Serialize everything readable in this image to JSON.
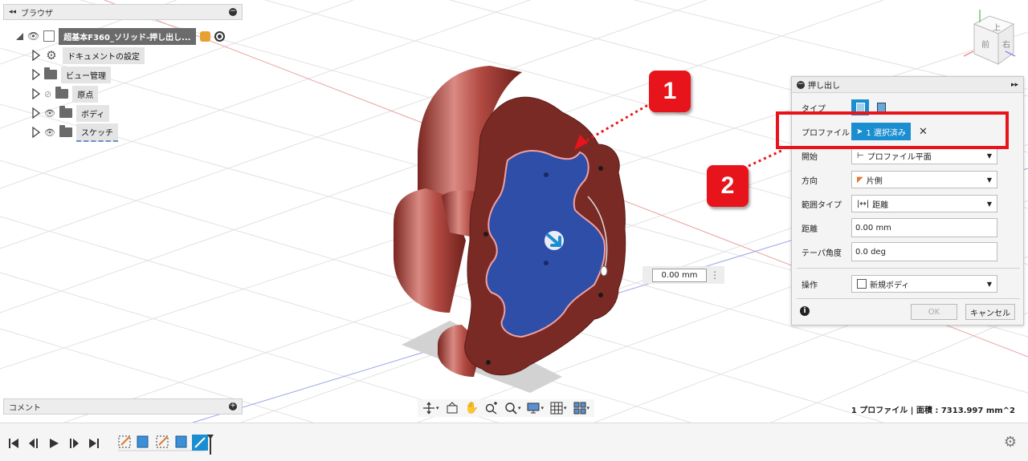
{
  "browser": {
    "title": "ブラウザ",
    "root_label": "超基本F360_ソリッド-押し出し...",
    "items": [
      {
        "label": "ドキュメントの設定",
        "icon": "gear-icon"
      },
      {
        "label": "ビュー管理",
        "icon": "folder-icon"
      },
      {
        "label": "原点",
        "icon": "folder-icon"
      },
      {
        "label": "ボディ",
        "icon": "folder-icon"
      },
      {
        "label": "スケッチ",
        "icon": "folder-icon"
      }
    ]
  },
  "comments": {
    "title": "コメント"
  },
  "view_cube": {
    "top": "上",
    "front": "前",
    "right": "右"
  },
  "dimension": {
    "value": "0.00 mm"
  },
  "status": {
    "text": "1 プロファイル | 面積 : 7313.997 mm^2"
  },
  "callouts": {
    "one": "1",
    "two": "2"
  },
  "extrude": {
    "title": "押し出し",
    "type_label": "タイプ",
    "profile_label": "プロファイル",
    "profile_value": "1 選択済み",
    "start_label": "開始",
    "start_value": "プロファイル平面",
    "direction_label": "方向",
    "direction_value": "片側",
    "extent_label": "範囲タイプ",
    "extent_value": "距離",
    "distance_label": "距離",
    "distance_value": "0.00 mm",
    "taper_label": "テーパ角度",
    "taper_value": "0.0 deg",
    "operation_label": "操作",
    "operation_value": "新規ボディ",
    "ok_label": "OK",
    "cancel_label": "キャンセル"
  },
  "colors": {
    "accent": "#1b8ed1",
    "callout_red": "#e8141b",
    "body_red": "#b0403a",
    "profile_blue": "#2e4ea8"
  }
}
